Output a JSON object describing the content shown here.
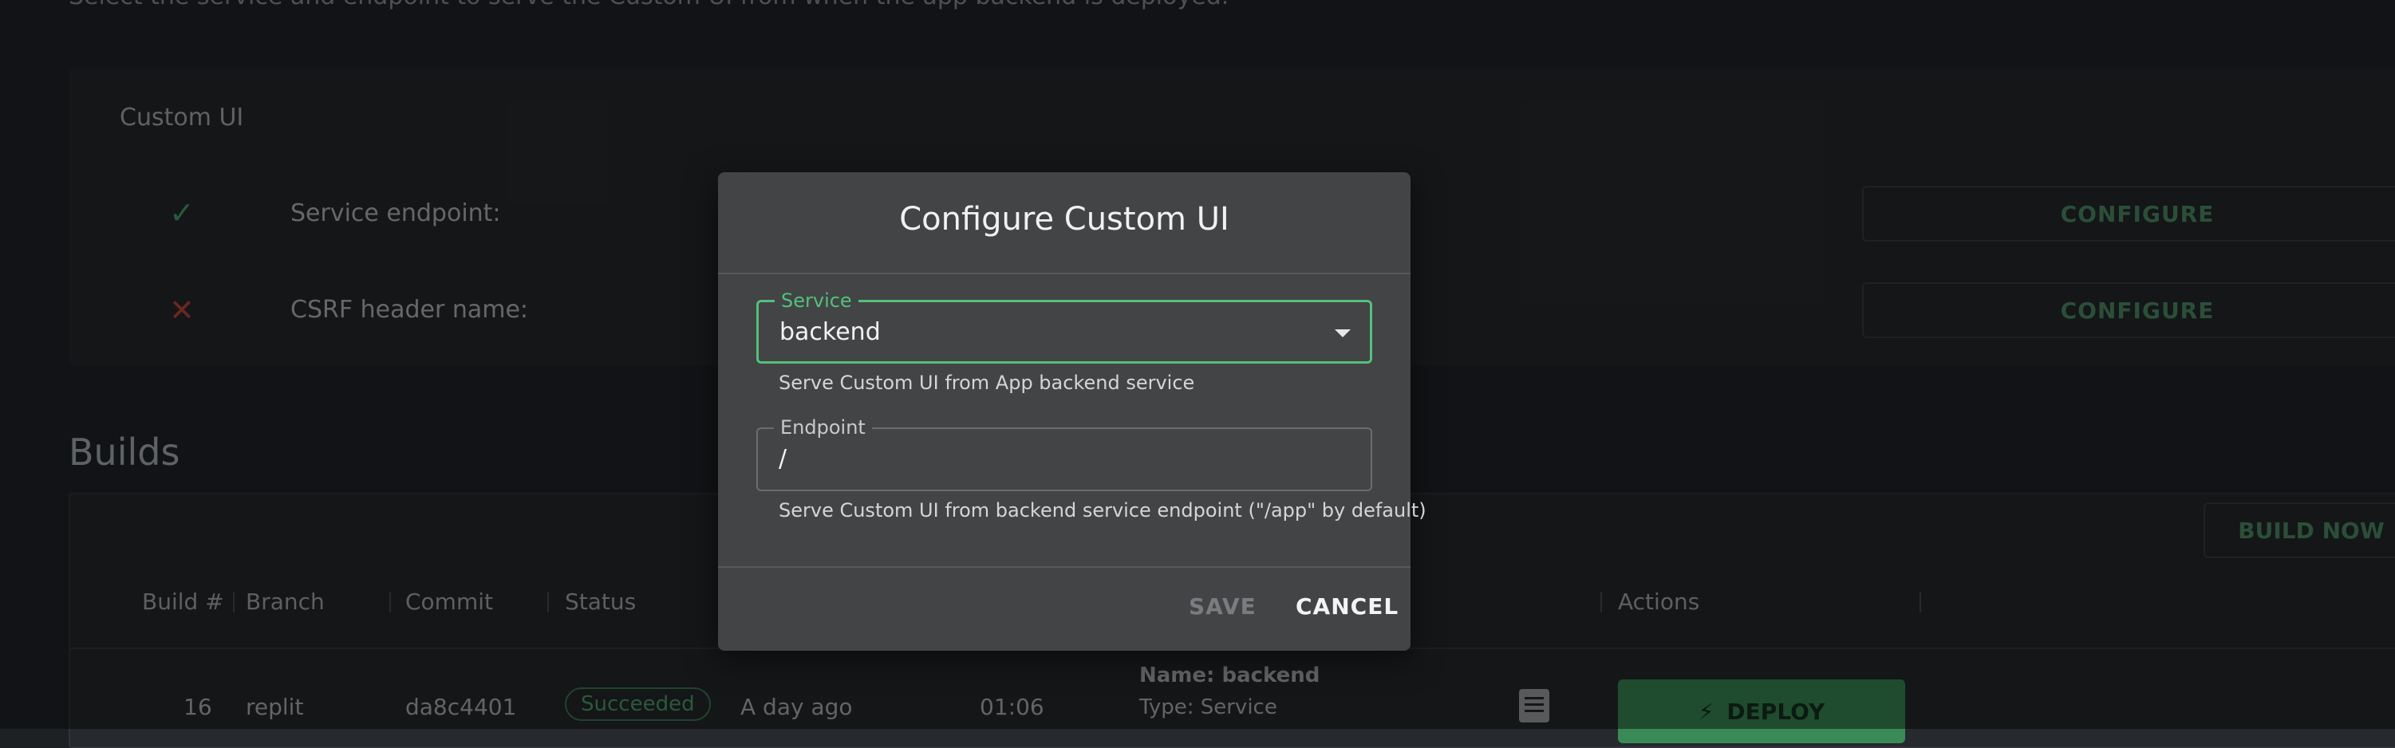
{
  "page": {
    "intro": "Select the service and endpoint to serve the Custom UI from when the app backend is deployed.",
    "custom_ui_card": {
      "title": "Custom UI",
      "rows": [
        {
          "label": "Service endpoint:",
          "status_icon": "check-icon",
          "button": "CONFIGURE"
        },
        {
          "label": "CSRF header name:",
          "status_icon": "cross-icon",
          "button": "CONFIGURE"
        }
      ]
    },
    "builds": {
      "title": "Builds",
      "build_now": "BUILD NOW",
      "columns": [
        "Build #",
        "Branch",
        "Commit",
        "Status",
        "Actions"
      ],
      "row": {
        "build": "16",
        "branch": "replit",
        "commit": "da8c4401",
        "status": "Succeeded",
        "time": "A day ago",
        "duration": "01:06",
        "name": "Name: backend",
        "type": "Type: Service",
        "deploy": "DEPLOY"
      }
    }
  },
  "modal": {
    "title": "Configure Custom UI",
    "service": {
      "label": "Service",
      "value": "backend",
      "helper": "Serve Custom UI from App backend service"
    },
    "endpoint": {
      "label": "Endpoint",
      "value": "/",
      "helper": "Serve Custom UI from backend service endpoint (\"/app\" by default)"
    },
    "save": "SAVE",
    "cancel": "CANCEL"
  },
  "colors": {
    "accent": "#54c07a",
    "success": "#4fa06c",
    "error": "#c5453f",
    "modal_bg": "#424446"
  }
}
